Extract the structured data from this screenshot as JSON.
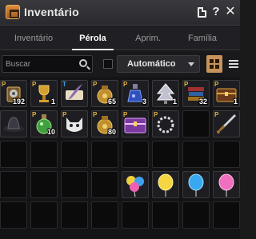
{
  "window": {
    "title": "Inventário"
  },
  "tabs": [
    {
      "label": "Inventário",
      "active": false
    },
    {
      "label": "Pérola",
      "active": true
    },
    {
      "label": "Aprim.",
      "active": false
    },
    {
      "label": "Família",
      "active": false
    }
  ],
  "toolbar": {
    "search_placeholder": "Buscar",
    "sort_label": "Automático"
  },
  "grid": {
    "rows": [
      [
        {
          "item": "cron-stone-box-icon",
          "badge": "P",
          "qty": "192"
        },
        {
          "item": "trophy-cup-icon",
          "badge": "P",
          "qty": "1"
        },
        {
          "item": "feather-scroll-icon",
          "badge": "T",
          "qty": ""
        },
        {
          "item": "gold-pouch-icon",
          "badge": "P",
          "qty": "65"
        },
        {
          "item": "blue-potion-icon",
          "badge": "P",
          "qty": "3"
        },
        {
          "item": "silver-tree-icon",
          "badge": "",
          "qty": "1"
        },
        {
          "item": "book-stack-icon",
          "badge": "P",
          "qty": "32"
        },
        {
          "item": "treasure-chest-icon",
          "badge": "P",
          "qty": "1"
        }
      ],
      [
        {
          "item": "dark-hat-icon",
          "badge": "",
          "qty": ""
        },
        {
          "item": "green-potion-icon",
          "badge": "P",
          "qty": "10"
        },
        {
          "item": "pet-cat-icon",
          "badge": "P",
          "qty": ""
        },
        {
          "item": "gold-pouch-icon",
          "badge": "P",
          "qty": "80"
        },
        {
          "item": "purple-chest-icon",
          "badge": "P",
          "qty": ""
        },
        {
          "item": "silver-ring-icon",
          "badge": "P",
          "qty": ""
        },
        {
          "item": "",
          "badge": "",
          "qty": ""
        },
        {
          "item": "sword-icon",
          "badge": "P",
          "qty": ""
        }
      ],
      [
        {
          "item": "",
          "badge": "",
          "qty": ""
        },
        {
          "item": "",
          "badge": "",
          "qty": ""
        },
        {
          "item": "",
          "badge": "",
          "qty": ""
        },
        {
          "item": "",
          "badge": "",
          "qty": ""
        },
        {
          "item": "",
          "badge": "",
          "qty": ""
        },
        {
          "item": "",
          "badge": "",
          "qty": ""
        },
        {
          "item": "",
          "badge": "",
          "qty": ""
        },
        {
          "item": "",
          "badge": "",
          "qty": ""
        }
      ],
      [
        {
          "item": "",
          "badge": "",
          "qty": ""
        },
        {
          "item": "",
          "badge": "",
          "qty": ""
        },
        {
          "item": "",
          "badge": "",
          "qty": ""
        },
        {
          "item": "",
          "badge": "",
          "qty": ""
        },
        {
          "item": "balloon-bundle-icon",
          "badge": "",
          "qty": ""
        },
        {
          "item": "yellow-balloon-icon",
          "badge": "",
          "qty": ""
        },
        {
          "item": "blue-balloon-icon",
          "badge": "",
          "qty": ""
        },
        {
          "item": "pink-balloon-icon",
          "badge": "",
          "qty": ""
        }
      ],
      [
        {
          "item": "",
          "badge": "",
          "qty": ""
        },
        {
          "item": "",
          "badge": "",
          "qty": ""
        },
        {
          "item": "",
          "badge": "",
          "qty": ""
        },
        {
          "item": "",
          "badge": "",
          "qty": ""
        },
        {
          "item": "",
          "badge": "",
          "qty": ""
        },
        {
          "item": "",
          "badge": "",
          "qty": ""
        },
        {
          "item": "",
          "badge": "",
          "qty": ""
        },
        {
          "item": "",
          "badge": "",
          "qty": ""
        }
      ]
    ]
  },
  "colors": {
    "accent": "#c8935a",
    "premium_badge": "#e0b040",
    "trade_badge": "#40a0e0"
  }
}
